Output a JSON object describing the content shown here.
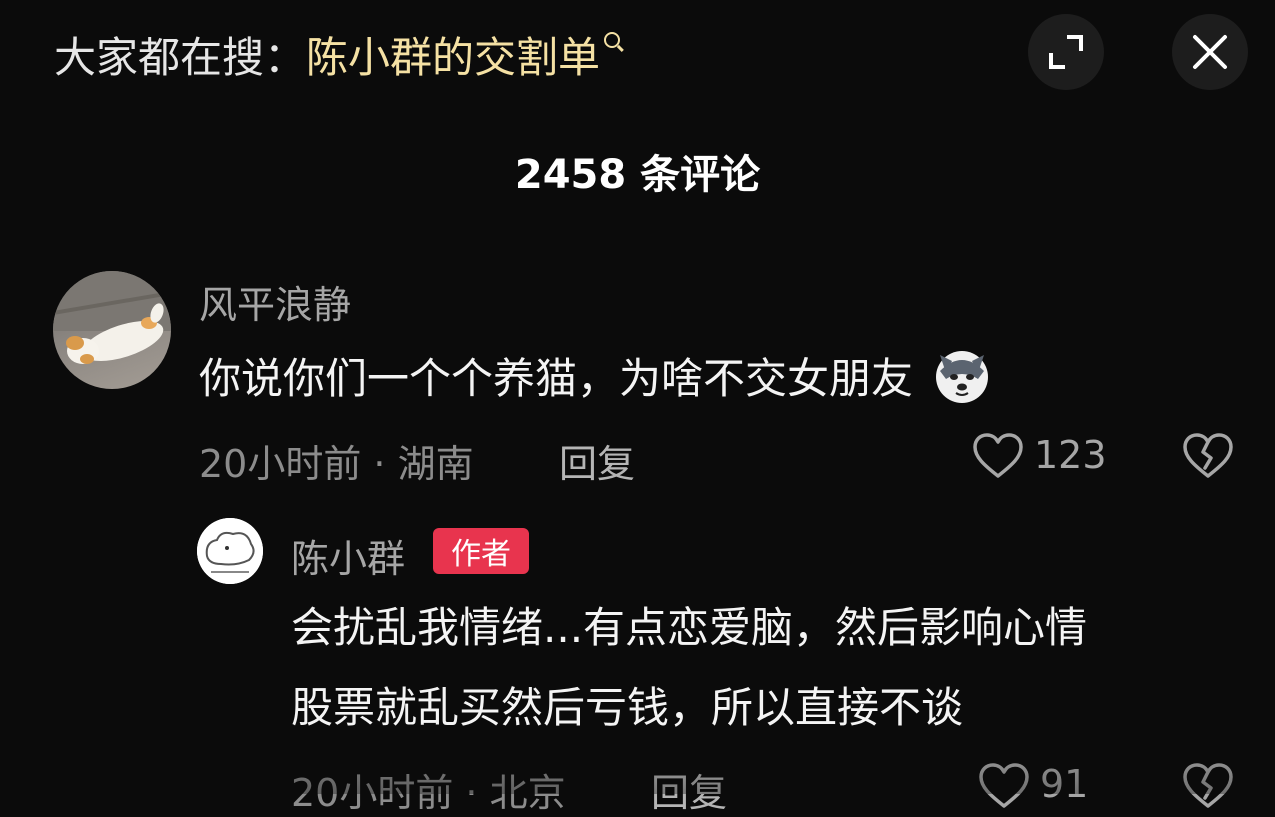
{
  "search": {
    "prefix": "大家都在搜：",
    "term": "陈小群的交割单"
  },
  "header": {
    "title": "2458 条评论"
  },
  "comments": [
    {
      "username": "风平浪静",
      "text": "你说你们一个个养猫，为啥不交女朋友",
      "meta": "20小时前 · 湖南",
      "reply_label": "回复",
      "likes": "123",
      "emoji": "husky-emoji"
    }
  ],
  "replies": [
    {
      "username": "陈小群",
      "badge": "作者",
      "text_line1": "会扰乱我情绪...有点恋爱脑，然后影响心情",
      "text_line2": "股票就乱买然后亏钱，所以直接不谈",
      "meta": "20小时前 · 北京",
      "reply_label": "回复",
      "likes": "91"
    }
  ],
  "colors": {
    "background": "#0b0b0b",
    "search_term": "#f5e1a4",
    "author_badge": "#e8344e"
  },
  "icons": {
    "expand": "expand-icon",
    "close": "close-icon",
    "like": "heart-icon",
    "dislike": "broken-heart-icon",
    "search": "search-icon"
  }
}
